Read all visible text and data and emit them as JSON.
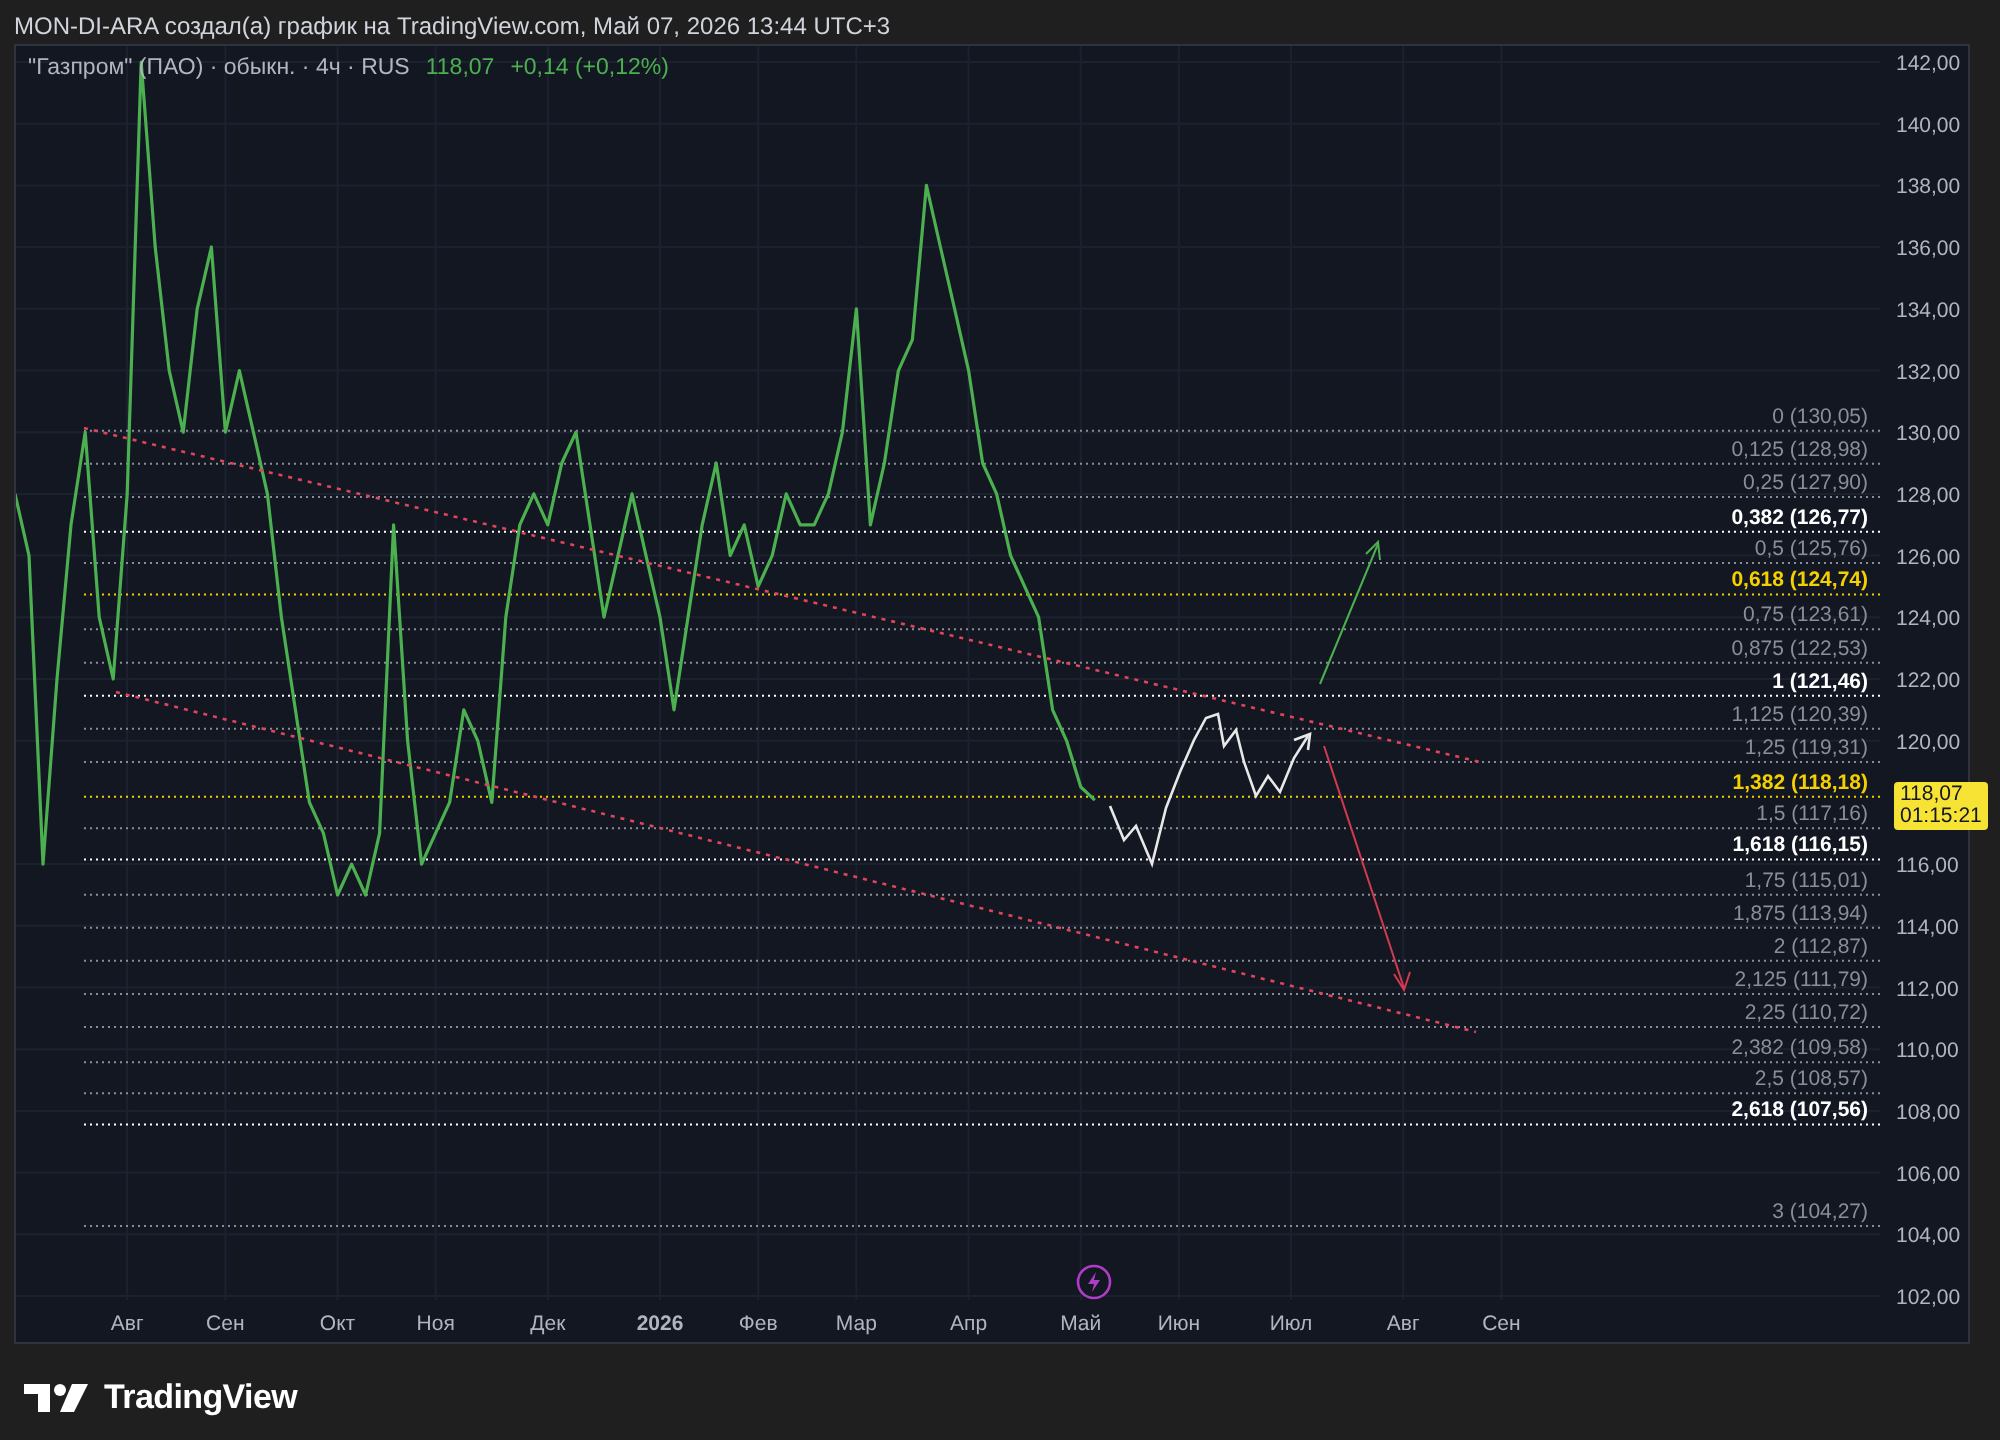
{
  "header": {
    "title": "MON-DI-ARA создал(а) график на TradingView.com, Май 07, 2026 13:44 UTC+3"
  },
  "legend": {
    "symbol": "\"Газпром\" (ПАО) · обыкн. · 4ч · RUS",
    "price": "118,07",
    "change": "+0,14 (+0,12%)"
  },
  "price_tag": {
    "price": "118,07",
    "countdown": "01:15:21"
  },
  "chart": {
    "chart_data": {
      "type": "line",
      "grid": true,
      "ylim": [
        102,
        142
      ],
      "categories": [
        null,
        null,
        null,
        null,
        null,
        null,
        null,
        null,
        "Авг",
        null,
        null,
        null,
        null,
        null,
        null,
        "Сен",
        null,
        null,
        null,
        null,
        null,
        null,
        null,
        "Окт",
        null,
        null,
        null,
        null,
        null,
        null,
        "Ноя",
        null,
        null,
        null,
        null,
        null,
        null,
        null,
        "Дек",
        null,
        null,
        null,
        null,
        null,
        null,
        null,
        "2026",
        null,
        null,
        null,
        null,
        null,
        null,
        "Фев",
        null,
        null,
        null,
        null,
        null,
        null,
        "Мар",
        null,
        null,
        null,
        null,
        null,
        null,
        null,
        "Апр",
        null,
        null,
        null,
        null,
        null,
        null,
        null,
        "Май",
        null,
        null,
        null,
        null,
        null,
        null,
        "Июн",
        null,
        null,
        null,
        null,
        null,
        null,
        null,
        "Июл",
        null,
        null,
        null,
        null,
        null,
        null,
        null,
        "Авг",
        null,
        null,
        null,
        null,
        null,
        null,
        "Сен",
        null,
        null,
        null,
        null,
        null,
        null,
        null,
        null,
        null,
        null,
        null,
        null,
        null,
        null,
        null,
        null,
        null,
        null,
        null,
        null,
        null,
        null,
        null,
        null,
        null,
        null,
        null
      ],
      "series": [
        {
          "color": "#4caf50",
          "values": [
            128,
            126,
            116,
            122,
            127,
            130,
            124,
            122,
            128,
            142,
            136,
            132,
            130,
            134,
            136,
            130,
            132,
            130,
            128,
            124,
            121,
            118,
            117,
            115,
            116,
            115,
            117,
            127,
            120,
            116,
            117,
            118,
            121,
            120,
            118,
            124,
            127,
            128,
            127,
            129,
            130,
            127,
            124,
            126,
            128,
            126,
            124,
            121,
            124,
            127,
            129,
            126,
            127,
            125,
            126,
            128,
            127,
            127,
            128,
            130,
            134,
            127,
            129,
            132,
            133,
            138,
            136,
            134,
            132,
            129,
            128,
            126,
            125,
            124,
            121,
            120,
            118.5,
            118.07,
            null,
            null,
            null,
            null,
            null,
            null,
            null,
            null,
            null,
            null,
            null,
            null,
            null,
            null,
            null,
            null,
            null,
            null,
            null,
            null,
            null,
            null,
            null,
            null,
            null,
            null,
            null,
            null,
            null,
            null,
            null,
            null,
            null,
            null,
            null,
            null,
            null,
            null,
            null,
            null,
            null,
            null,
            null,
            null,
            null,
            null,
            null,
            null,
            null,
            null,
            null,
            null,
            null,
            null,
            null,
            null
          ]
        }
      ],
      "yticks": [
        {
          "value": 142,
          "label": "142,00"
        },
        {
          "value": 140,
          "label": "140,00"
        },
        {
          "value": 138,
          "label": "138,00"
        },
        {
          "value": 136,
          "label": "136,00"
        },
        {
          "value": 134,
          "label": "134,00"
        },
        {
          "value": 132,
          "label": "132,00"
        },
        {
          "value": 130,
          "label": "130,00"
        },
        {
          "value": 128,
          "label": "128,00"
        },
        {
          "value": 126,
          "label": "126,00"
        },
        {
          "value": 124,
          "label": "124,00"
        },
        {
          "value": 122,
          "label": "122,00"
        },
        {
          "value": 120,
          "label": "120,00"
        },
        {
          "value": 116,
          "label": "116,00"
        },
        {
          "value": 114,
          "label": "114,00"
        },
        {
          "value": 112,
          "label": "112,00"
        },
        {
          "value": 110,
          "label": "110,00"
        },
        {
          "value": 108,
          "label": "108,00"
        },
        {
          "value": 106,
          "label": "106,00"
        },
        {
          "value": 104,
          "label": "104,00"
        },
        {
          "value": 102,
          "label": "102,00"
        }
      ],
      "ref_lines": [
        {
          "axis": "y",
          "color": "#8a8e99",
          "label": "0 (130,05)",
          "value": 130.05
        },
        {
          "axis": "y",
          "color": "#8a8e99",
          "label": "0,125 (128,98)",
          "value": 128.98
        },
        {
          "axis": "y",
          "color": "#8a8e99",
          "label": "0,25 (127,90)",
          "value": 127.9
        },
        {
          "axis": "y",
          "color": "#ffffff",
          "label": "0,382 (126,77)",
          "value": 126.77
        },
        {
          "axis": "y",
          "color": "#8a8e99",
          "label": "0,5 (125,76)",
          "value": 125.76
        },
        {
          "axis": "y",
          "color": "#f5d000",
          "label": "0,618 (124,74)",
          "value": 124.74
        },
        {
          "axis": "y",
          "color": "#8a8e99",
          "label": "0,75 (123,61)",
          "value": 123.61
        },
        {
          "axis": "y",
          "color": "#8a8e99",
          "label": "0,875 (122,53)",
          "value": 122.53
        },
        {
          "axis": "y",
          "color": "#ffffff",
          "label": "1 (121,46)",
          "value": 121.46
        },
        {
          "axis": "y",
          "color": "#8a8e99",
          "label": "1,125 (120,39)",
          "value": 120.39
        },
        {
          "axis": "y",
          "color": "#8a8e99",
          "label": "1,25 (119,31)",
          "value": 119.31
        },
        {
          "axis": "y",
          "color": "#f5d000",
          "label": "1,382 (118,18)",
          "value": 118.18
        },
        {
          "axis": "y",
          "color": "#8a8e99",
          "label": "1,5 (117,16)",
          "value": 117.16
        },
        {
          "axis": "y",
          "color": "#ffffff",
          "label": "1,618 (116,15)",
          "value": 116.15
        },
        {
          "axis": "y",
          "color": "#8a8e99",
          "label": "1,75 (115,01)",
          "value": 115.01
        },
        {
          "axis": "y",
          "color": "#8a8e99",
          "label": "1,875 (113,94)",
          "value": 113.94
        },
        {
          "axis": "y",
          "color": "#8a8e99",
          "label": "2 (112,87)",
          "value": 112.87
        },
        {
          "axis": "y",
          "color": "#8a8e99",
          "label": "2,125 (111,79)",
          "value": 111.79
        },
        {
          "axis": "y",
          "color": "#8a8e99",
          "label": "2,25 (110,72)",
          "value": 110.72
        },
        {
          "axis": "y",
          "color": "#8a8e99",
          "label": "2,382 (109,58)",
          "value": 109.58
        },
        {
          "axis": "y",
          "color": "#8a8e99",
          "label": "2,5 (108,57)",
          "value": 108.57
        },
        {
          "axis": "y",
          "color": "#ffffff",
          "label": "2,618 (107,56)",
          "value": 107.56
        },
        {
          "axis": "y",
          "color": "#8a8e99",
          "label": "3 (104,27)",
          "value": 104.27
        }
      ]
    }
  },
  "footer": {
    "brand": "TradingView"
  }
}
